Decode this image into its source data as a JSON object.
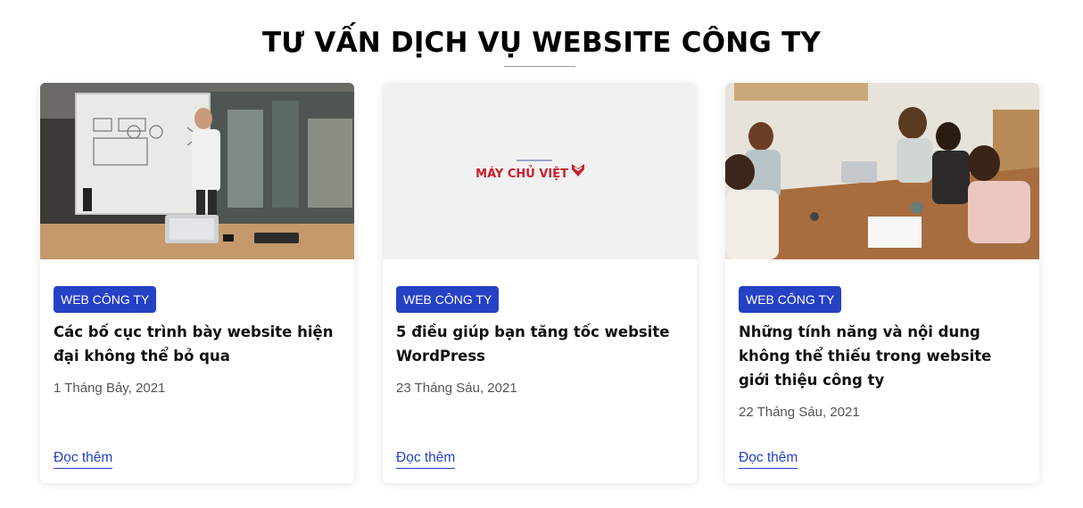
{
  "section": {
    "title": "TƯ VẤN DỊCH VỤ WEBSITE CÔNG TY"
  },
  "cards": [
    {
      "category": "WEB CÔNG TY",
      "title": "Các bố cục trình bày website hiện đại không thể bỏ qua",
      "date": "1 Tháng Bảy, 2021",
      "read_more": "Đọc thêm",
      "image_icon": "whiteboard-office-photo"
    },
    {
      "category": "WEB CÔNG TY",
      "title": "5 điều giúp bạn tăng tốc website WordPress",
      "date": "23 Tháng Sáu, 2021",
      "read_more": "Đọc thêm",
      "image_icon": "may-chu-viet-logo",
      "logo_text": "MÁY CHỦ VIỆT"
    },
    {
      "category": "WEB CÔNG TY",
      "title": "Những tính năng và nội dung không thể thiếu trong website giới thiệu công ty",
      "date": "22 Tháng Sáu, 2021",
      "read_more": "Đọc thêm",
      "image_icon": "team-meeting-photo"
    }
  ],
  "colors": {
    "accent": "#2541c4",
    "title": "#000000",
    "logo_red": "#d0202e"
  }
}
